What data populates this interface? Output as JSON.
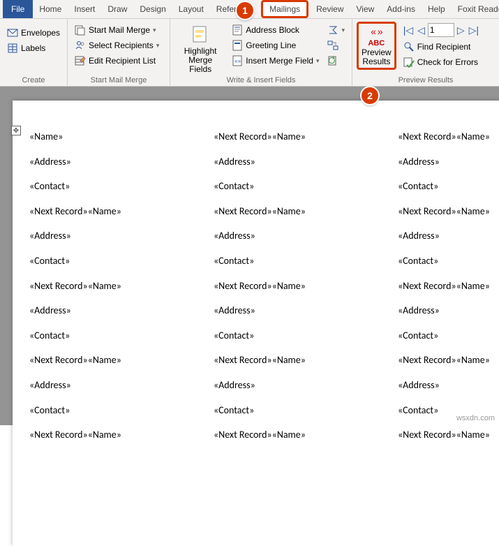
{
  "tabs": {
    "file": "File",
    "home": "Home",
    "insert": "Insert",
    "draw": "Draw",
    "design": "Design",
    "layout": "Layout",
    "refer": "Refer",
    "mailings": "Mailings",
    "review": "Review",
    "view": "View",
    "addins": "Add-ins",
    "help": "Help",
    "foxit": "Foxit Reader PD"
  },
  "callouts": {
    "one": "1",
    "two": "2"
  },
  "create": {
    "envelopes": "Envelopes",
    "labels": "Labels",
    "group": "Create"
  },
  "start": {
    "startmm": "Start Mail Merge",
    "selrec": "Select Recipients",
    "editrec": "Edit Recipient List",
    "group": "Start Mail Merge"
  },
  "write": {
    "highlight1": "Highlight",
    "highlight2": "Merge Fields",
    "addrblock": "Address Block",
    "greet": "Greeting Line",
    "insertmf": "Insert Merge Field",
    "group": "Write & Insert Fields"
  },
  "preview": {
    "line1": "ABC",
    "line2": "Preview",
    "line3": "Results",
    "findrec": "Find Recipient",
    "checkerr": "Check for Errors",
    "group": "Preview Results",
    "record": "1"
  },
  "fields": {
    "name": "«Name»",
    "address": "«Address»",
    "contact": "«Contact»",
    "next_name": "«Next Record»«Name»"
  },
  "watermark": "wsxdn.com"
}
